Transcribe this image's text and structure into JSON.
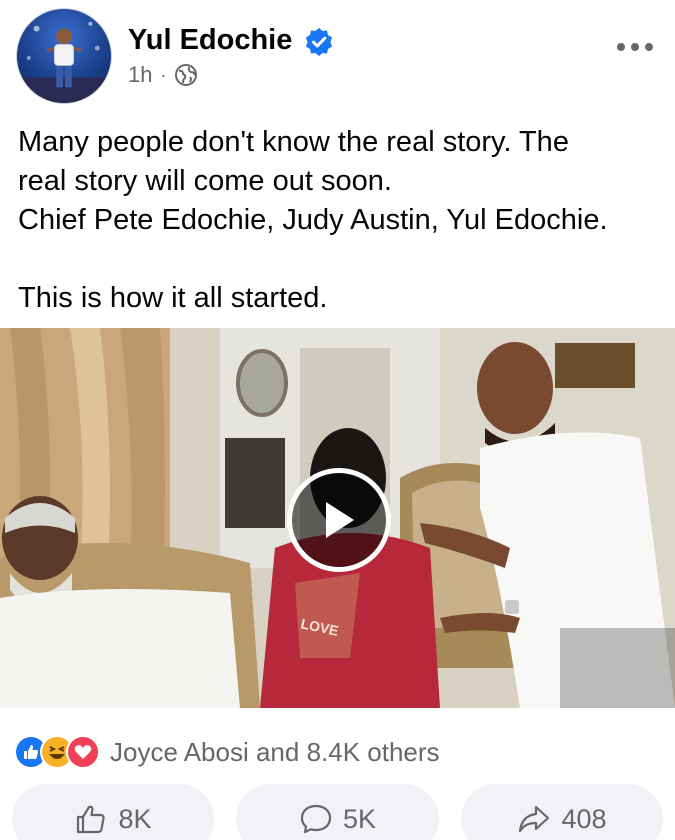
{
  "post": {
    "author": "Yul Edochie",
    "time": "1h",
    "separator": "·",
    "text_lines": [
      "Many people don't know the real story. The",
      "real story will come out soon.",
      "Chief Pete Edochie, Judy Austin, Yul Edochie.",
      "",
      "This is how it all started."
    ],
    "video_caption": "LOVE"
  },
  "reactions": {
    "icons": [
      "like-icon",
      "haha-icon",
      "love-icon"
    ],
    "summary": "Joyce Abosi and 8.4K others"
  },
  "actions": {
    "like_count": "8K",
    "comment_count": "5K",
    "share_count": "408"
  },
  "colors": {
    "verified": "#1877f2",
    "secondary_text": "#65676b",
    "button_bg": "#f0f2f5",
    "like": "#1877f2",
    "haha": "#f7b125",
    "love": "#f33e58"
  }
}
